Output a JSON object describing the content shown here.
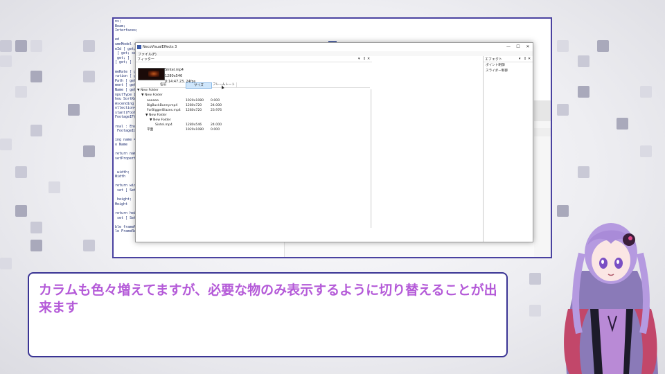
{
  "app": {
    "title": "NecoVisualEffects 3",
    "menu_file": "ファイル(F)",
    "window_controls": [
      "—",
      "☐",
      "✕"
    ]
  },
  "filter_panel": {
    "title": "フィッター",
    "controls": [
      "▾",
      "⇕",
      "✕"
    ],
    "selected_file": "Sintel.mp4",
    "selected_resolution": "1280x546",
    "selected_duration": "0:14:47.23, 24fps",
    "columns": [
      "名前",
      "サイズ",
      "フレームレート"
    ],
    "tree": [
      {
        "label": "▼ New Folder",
        "size": "",
        "fps": ""
      },
      {
        "label": "▼ New Folder",
        "size": "",
        "fps": ""
      },
      {
        "label": "aaaaaa",
        "size": "1920x1080",
        "fps": "0.000"
      },
      {
        "label": "BigBuckBunny.mp4",
        "size": "1280x720",
        "fps": "24.000"
      },
      {
        "label": "ForBiggerBlazes.mp4",
        "size": "1280x720",
        "fps": "23.976"
      },
      {
        "label": "▼ New Folder",
        "size": "",
        "fps": ""
      },
      {
        "label": "▼ New Folder",
        "size": "",
        "fps": ""
      },
      {
        "label": "Sintel.mp4",
        "size": "1280x546",
        "fps": "24.000"
      },
      {
        "label": "平面",
        "size": "1920x1080",
        "fps": "0.000"
      }
    ]
  },
  "effect_panel": {
    "title": "エフェクト",
    "controls": [
      "▾",
      "⇕",
      "✕"
    ],
    "items": [
      "ポイント制御",
      "スライダー制御"
    ]
  },
  "code_lines": [
    "ns;",
    "Beam;",
    "Interfaces;",
    "",
    "ed",
    "umnModel : I",
    "eId [ get;",
    " [ get; se",
    " get; ]",
    "[ get; ]",
    "",
    "meRate [ get;",
    "ration [ get;",
    "Path [ get;",
    "ment [ get; se",
    "Name [ get;",
    "nputType [ ge",
    "hou SortKey",
    "Ascending [ g",
    "ollection<F",
    "stant(Footage",
    "FootageIF(oot",
    "",
    "rnal : Enabl",
    " FootageId [",
    "",
    "ing name = \"",
    "o Name",
    "",
    "return name;",
    "setPropertyCh",
    "",
    "",
    " width;",
    "Width",
    "",
    "return width;",
    " set [ SetPr",
    "",
    " height;",
    "Height",
    "",
    "return height",
    " set [ SetPr",
    "",
    "ble frameRate;",
    "le FrameRate"
  ],
  "subtitle": "カラムも色々増えてますが、必要な物のみ表示するように切り替えることが出来ます"
}
